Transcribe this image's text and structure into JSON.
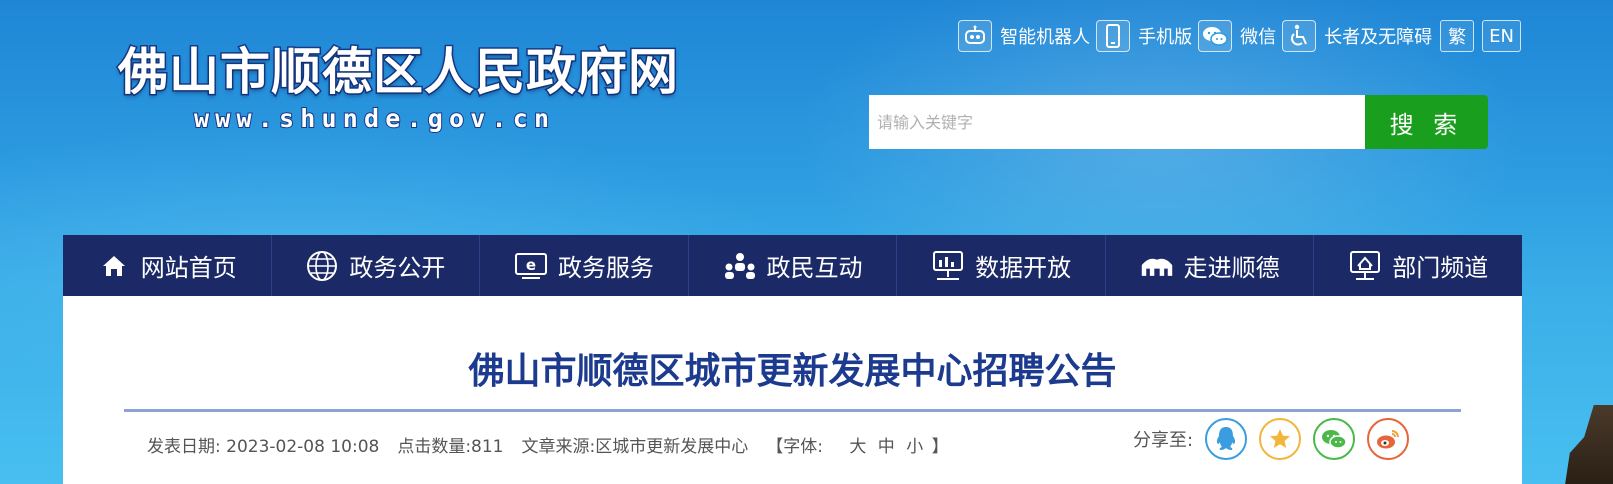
{
  "site": {
    "title": "佛山市顺德区人民政府网",
    "url": "www.shunde.gov.cn"
  },
  "toplinks": {
    "robot": "智能机器人",
    "mobile": "手机版",
    "wechat": "微信",
    "accessible": "长者及无障碍",
    "traditional": "繁",
    "english": "EN"
  },
  "search": {
    "placeholder": "请输入关键字",
    "button": "搜 索"
  },
  "nav": {
    "items": [
      {
        "label": "网站首页",
        "icon": "home-icon"
      },
      {
        "label": "政务公开",
        "icon": "globe-icon"
      },
      {
        "label": "政务服务",
        "icon": "e-service-icon"
      },
      {
        "label": "政民互动",
        "icon": "people-icon"
      },
      {
        "label": "数据开放",
        "icon": "data-screen-icon"
      },
      {
        "label": "走进顺德",
        "icon": "architecture-icon"
      },
      {
        "label": "部门频道",
        "icon": "department-icon"
      }
    ]
  },
  "article": {
    "title": "佛山市顺德区城市更新发展中心招聘公告",
    "publish_date": "发表日期: 2023-02-08 10:08",
    "clicks": "点击数量:811",
    "source": "文章来源:区城市更新发展中心",
    "font_label_open": "【字体:",
    "font_large": "大",
    "font_medium": "中",
    "font_small": "小",
    "font_label_close": "】",
    "share_label": "分享至:"
  },
  "colors": {
    "nav_bg": "#1b2a66",
    "search_button": "#1a9e1e",
    "title": "#1c3b8f",
    "share_qq": "#3a9de0",
    "share_qzone": "#f2b63c",
    "share_wechat": "#4cb84a",
    "share_weibo": "#e8643a"
  }
}
